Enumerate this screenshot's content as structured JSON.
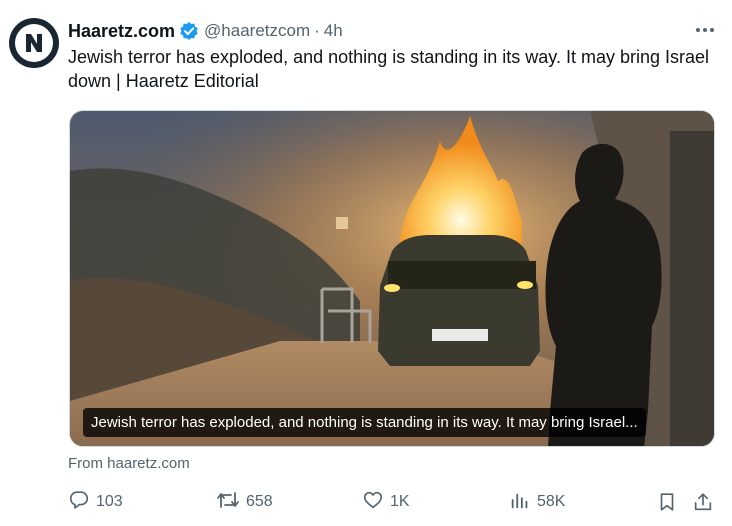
{
  "author": {
    "display_name": "Haaretz.com",
    "handle": "@haaretzcom",
    "separator": "·",
    "time": "4h"
  },
  "tweet": {
    "text": "Jewish terror has exploded, and nothing is standing in its way. It may bring Israel down | Haaretz Editorial"
  },
  "media": {
    "caption": "Jewish terror has exploded, and nothing is standing in its way. It may bring Israel..."
  },
  "card": {
    "source": "From haaretz.com"
  },
  "actions": {
    "replies": "103",
    "reposts": "658",
    "likes": "1K",
    "views": "58K"
  },
  "icons": {
    "avatar": "haaretz-logo",
    "verified": "verified-badge-icon",
    "more": "more-icon",
    "reply": "reply-icon",
    "repost": "repost-icon",
    "like": "heart-icon",
    "views": "views-icon",
    "bookmark": "bookmark-icon",
    "share": "share-icon"
  },
  "colors": {
    "text": "#0f1419",
    "secondary": "#536471",
    "verified": "#1d9bf0"
  }
}
